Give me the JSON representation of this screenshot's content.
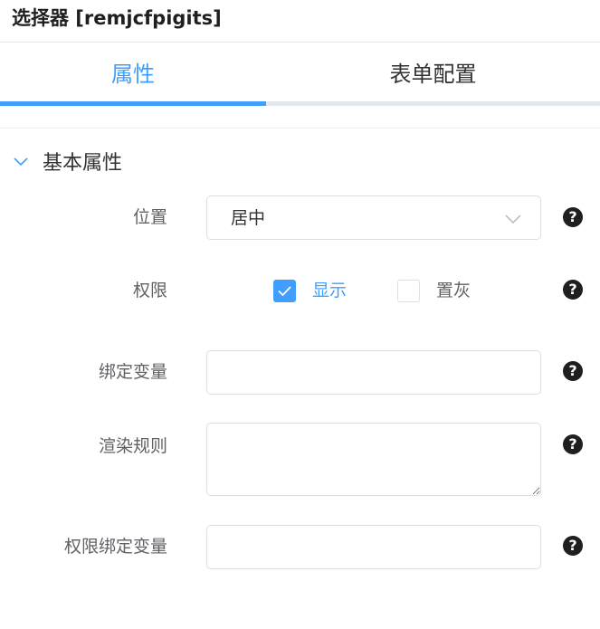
{
  "panel": {
    "title": "选择器 [remjcfpigits]"
  },
  "tabs": [
    {
      "label": "属性",
      "active": true
    },
    {
      "label": "表单配置",
      "active": false
    }
  ],
  "section": {
    "title": "基本属性",
    "expanded": true
  },
  "form": {
    "position": {
      "label": "位置",
      "value": "居中"
    },
    "permission": {
      "label": "权限",
      "options": [
        {
          "label": "显示",
          "checked": true
        },
        {
          "label": "置灰",
          "checked": false
        }
      ]
    },
    "bind_variable": {
      "label": "绑定变量",
      "value": ""
    },
    "render_rule": {
      "label": "渲染规则",
      "value": ""
    },
    "permission_bind_variable": {
      "label": "权限绑定变量",
      "value": ""
    }
  },
  "help_symbol": "?",
  "colors": {
    "accent": "#409eff",
    "border": "#dcdfe6",
    "text": "#303133",
    "label": "#606266"
  },
  "icons": {
    "collapse": "chevron-down-icon",
    "select_arrow": "chevron-down-icon",
    "help": "question-circle-icon",
    "check": "check-icon"
  }
}
